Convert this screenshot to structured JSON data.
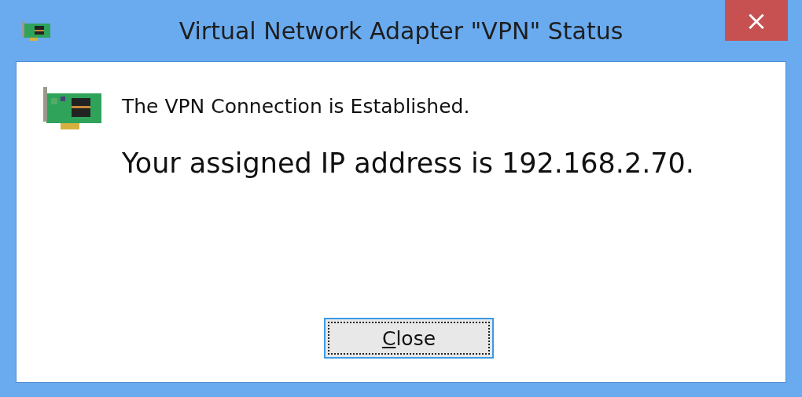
{
  "window": {
    "title": "Virtual Network Adapter \"VPN\" Status",
    "close_glyph": "×"
  },
  "message": {
    "heading": "The VPN Connection is Established.",
    "detail": "Your assigned IP address is 192.168.2.70."
  },
  "button": {
    "label": "Close",
    "first_letter_underlined": true,
    "focused": true
  }
}
